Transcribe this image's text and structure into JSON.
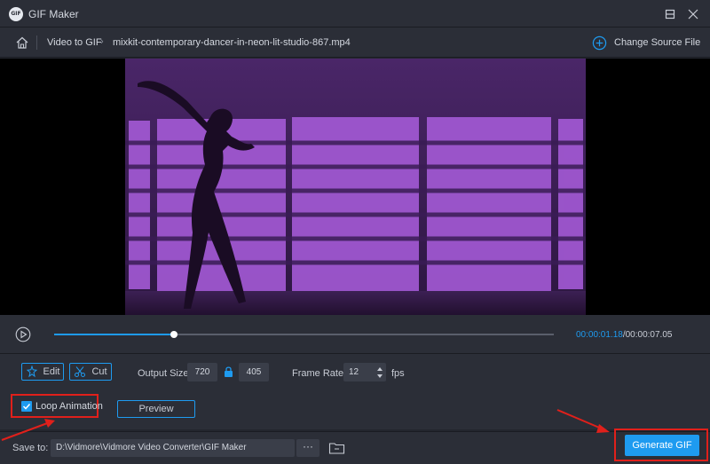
{
  "app": {
    "title": "GIF Maker",
    "logo_text": "GIF"
  },
  "window_controls": [
    "minimize-icon",
    "maximize-icon",
    "close-icon"
  ],
  "breadcrumb": {
    "root": "Video to GIF",
    "file": "mixkit-contemporary-dancer-in-neon-lit-studio-867.mp4"
  },
  "change_source": {
    "label": "Change Source File"
  },
  "player": {
    "current_time": "00:00:01.18",
    "total_time": "00:00:07.05",
    "separator": "/",
    "progress": 0.24
  },
  "edit": {
    "edit_label": "Edit",
    "cut_label": "Cut"
  },
  "output_size": {
    "label": "Output Size:",
    "width": "720",
    "height": "405"
  },
  "frame_rate": {
    "label": "Frame Rate:",
    "value": "12",
    "unit": "fps"
  },
  "loop": {
    "label": "Loop Animation",
    "checked": true
  },
  "preview": {
    "label": "Preview"
  },
  "save": {
    "label": "Save to:",
    "path": "D:\\Vidmore\\Vidmore Video Converter\\GIF Maker",
    "more": "···"
  },
  "generate": {
    "label": "Generate GIF"
  },
  "colors": {
    "accent": "#1e9bf0",
    "highlight": "#e0201b",
    "panel": "#2b2e37",
    "video_tint": "#3a1c55"
  }
}
